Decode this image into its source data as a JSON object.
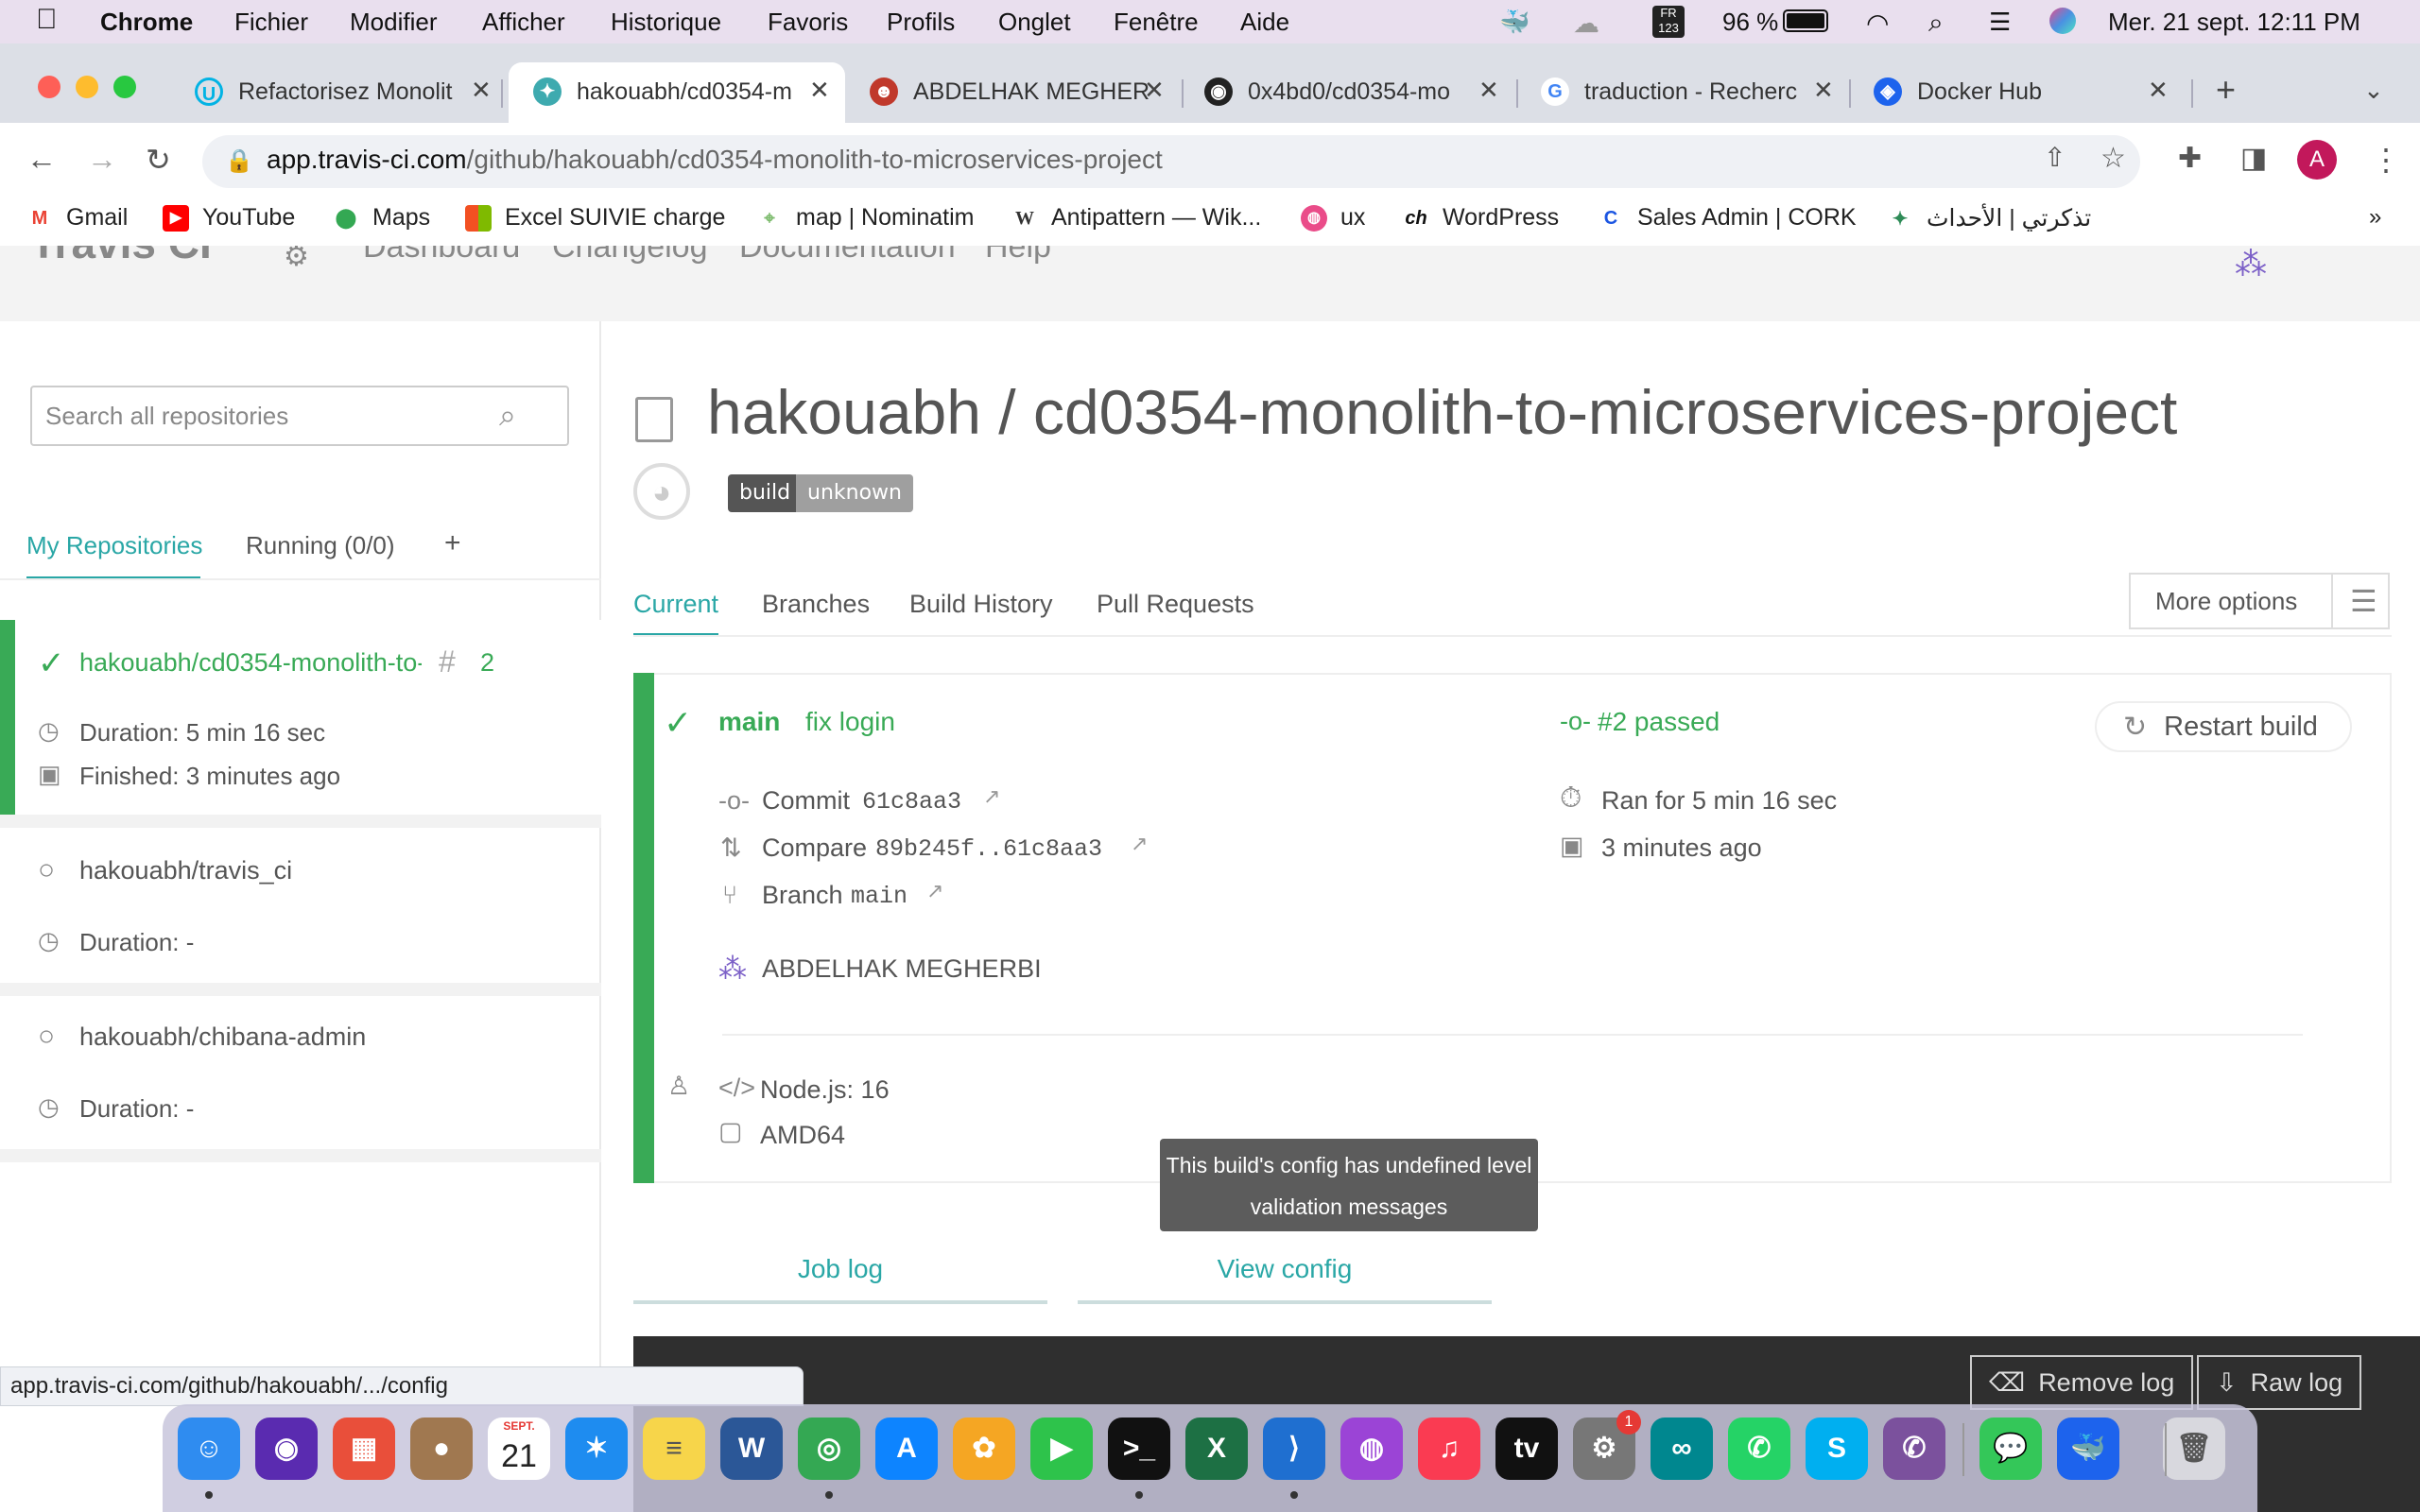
{
  "menubar": {
    "app": "Chrome",
    "items": [
      "Fichier",
      "Modifier",
      "Afficher",
      "Historique",
      "Favoris",
      "Profils",
      "Onglet",
      "Fenêtre",
      "Aide"
    ],
    "battery": "96 %",
    "input_source": "FR",
    "datetime": "Mer. 21 sept.  12:11 PM"
  },
  "browser": {
    "tabs": [
      {
        "label": "Refactorisez Monolit",
        "icon": "udacity-icon",
        "color": "#02b3e4"
      },
      {
        "label": "hakouabh/cd0354-m",
        "icon": "travis-icon",
        "color": "#3eaaaf",
        "active": true
      },
      {
        "label": "ABDELHAK MEGHER",
        "icon": "avatar-icon",
        "color": "#c0392b"
      },
      {
        "label": "0x4bd0/cd0354-mo",
        "icon": "github-icon",
        "color": "#222222"
      },
      {
        "label": "traduction - Recherc",
        "icon": "google-icon",
        "color": "#4285f4"
      },
      {
        "label": "Docker Hub",
        "icon": "docker-icon",
        "color": "#1d63ed"
      }
    ],
    "url_host": "app.travis-ci.com",
    "url_path": "/github/hakouabh/cd0354-monolith-to-microservices-project",
    "profile_initial": "A",
    "bookmarks": [
      {
        "label": "Gmail",
        "icon": "gmail-icon",
        "color": "#ea4335"
      },
      {
        "label": "YouTube",
        "icon": "youtube-icon",
        "color": "#ff0000"
      },
      {
        "label": "Maps",
        "icon": "maps-icon",
        "color": "#34a853"
      },
      {
        "label": "Excel SUIVIE charge",
        "icon": "microsoft-icon",
        "color": "#f25022"
      },
      {
        "label": "map | Nominatim",
        "icon": "nominatim-icon",
        "color": "#7ebc6f"
      },
      {
        "label": "Antipattern — Wik...",
        "icon": "wikipedia-icon",
        "color": "#333333"
      },
      {
        "label": "ux",
        "icon": "dribbble-icon",
        "color": "#ea4c89"
      },
      {
        "label": "WordPress",
        "icon": "wordpress-icon",
        "color": "#111111"
      },
      {
        "label": "Sales Admin | CORK",
        "icon": "cork-icon",
        "color": "#1b55e2"
      },
      {
        "label": "تذكرتي | الأحداث",
        "icon": "ticket-icon",
        "color": "#2e8b57"
      }
    ]
  },
  "travis_header": {
    "logo_text": "Travis CI",
    "nav": [
      "Dashboard",
      "Changelog",
      "Documentation",
      "Help"
    ]
  },
  "sidebar": {
    "search_placeholder": "Search all repositories",
    "tabs": [
      "My Repositories",
      "Running (0/0)",
      "+"
    ],
    "repos": [
      {
        "name": "hakouabh/cd0354-monolith-to-",
        "build_number": "2",
        "duration": "Duration: 5 min 16 sec",
        "finished": "Finished: 3 minutes ago",
        "status": "passed"
      },
      {
        "name": "hakouabh/travis_ci",
        "duration": "Duration: -",
        "status": "none"
      },
      {
        "name": "hakouabh/chibana-admin",
        "duration": "Duration: -",
        "status": "none"
      }
    ]
  },
  "main": {
    "title": "hakouabh / cd0354-monolith-to-microservices-project",
    "badge_left": "build",
    "badge_right": "unknown",
    "tabs": [
      "Current",
      "Branches",
      "Build History",
      "Pull Requests"
    ],
    "more_options": "More options",
    "build": {
      "branch": "main",
      "message": "fix login",
      "number_status": "#2 passed",
      "restart": "Restart build",
      "commit_label": "Commit",
      "commit": "61c8aa3",
      "compare_label": "Compare",
      "compare": "89b245f..61c8aa3",
      "branch_label": "Branch",
      "branch_value": "main",
      "author": "ABDELHAK MEGHERBI",
      "ran_for": "Ran for 5 min 16 sec",
      "time_ago": "3 minutes ago",
      "language": "Node.js: 16",
      "arch": "AMD64"
    },
    "tooltip": "This build's config has undefined level validation messages",
    "log_tabs": [
      "Job log",
      "View config"
    ],
    "log_buttons": [
      "Remove log",
      "Raw log"
    ]
  },
  "statusbar": "app.travis-ci.com/github/hakouabh/.../config",
  "dock": {
    "apps": [
      {
        "name": "Finder",
        "color": "#2f8cf0",
        "glyph": "☺"
      },
      {
        "name": "Siri",
        "color": "#5a2bb0",
        "glyph": "◉"
      },
      {
        "name": "Launchpad",
        "color": "#e94f3a",
        "glyph": "▦"
      },
      {
        "name": "Contacts",
        "color": "#a07850",
        "glyph": "●"
      },
      {
        "name": "Calendar",
        "color": "#ffffff",
        "glyph": "21"
      },
      {
        "name": "Safari",
        "color": "#1e8cf0",
        "glyph": "✶"
      },
      {
        "name": "Notes",
        "color": "#f7d54a",
        "glyph": "≡"
      },
      {
        "name": "Word",
        "color": "#2b5797",
        "glyph": "W"
      },
      {
        "name": "Chrome",
        "color": "#34a853",
        "glyph": "◎"
      },
      {
        "name": "App Store",
        "color": "#0d84ff",
        "glyph": "A"
      },
      {
        "name": "Photos",
        "color": "#f5a623",
        "glyph": "✿"
      },
      {
        "name": "FaceTime",
        "color": "#2ec34b",
        "glyph": "▶"
      },
      {
        "name": "Terminal",
        "color": "#111111",
        "glyph": ">_"
      },
      {
        "name": "Excel",
        "color": "#1d7044",
        "glyph": "X"
      },
      {
        "name": "VS Code",
        "color": "#1f6fd0",
        "glyph": "⟩"
      },
      {
        "name": "Podcasts",
        "color": "#9b44d6",
        "glyph": "◍"
      },
      {
        "name": "Music",
        "color": "#fa3b52",
        "glyph": "♫"
      },
      {
        "name": "Apple TV",
        "color": "#111111",
        "glyph": "tv"
      },
      {
        "name": "System Preferences",
        "color": "#777777",
        "glyph": "⚙",
        "badge": "1"
      },
      {
        "name": "Arduino",
        "color": "#00878f",
        "glyph": "∞"
      },
      {
        "name": "WhatsApp",
        "color": "#25d366",
        "glyph": "✆"
      },
      {
        "name": "Skype",
        "color": "#00aff0",
        "glyph": "S"
      },
      {
        "name": "Viber",
        "color": "#7b519d",
        "glyph": "✆"
      },
      {
        "name": "Messages",
        "color": "#34c759",
        "glyph": "💬"
      },
      {
        "name": "Docker",
        "color": "#1d63ed",
        "glyph": "🐳"
      },
      {
        "name": "Trash",
        "color": "#d8d8de",
        "glyph": "🗑"
      }
    ],
    "calendar_month": "SEPT."
  },
  "colors": {
    "travis_green": "#39aa56",
    "travis_teal": "#2aa7a6",
    "badge_dark": "#555555",
    "badge_grey": "#9f9f9f"
  }
}
